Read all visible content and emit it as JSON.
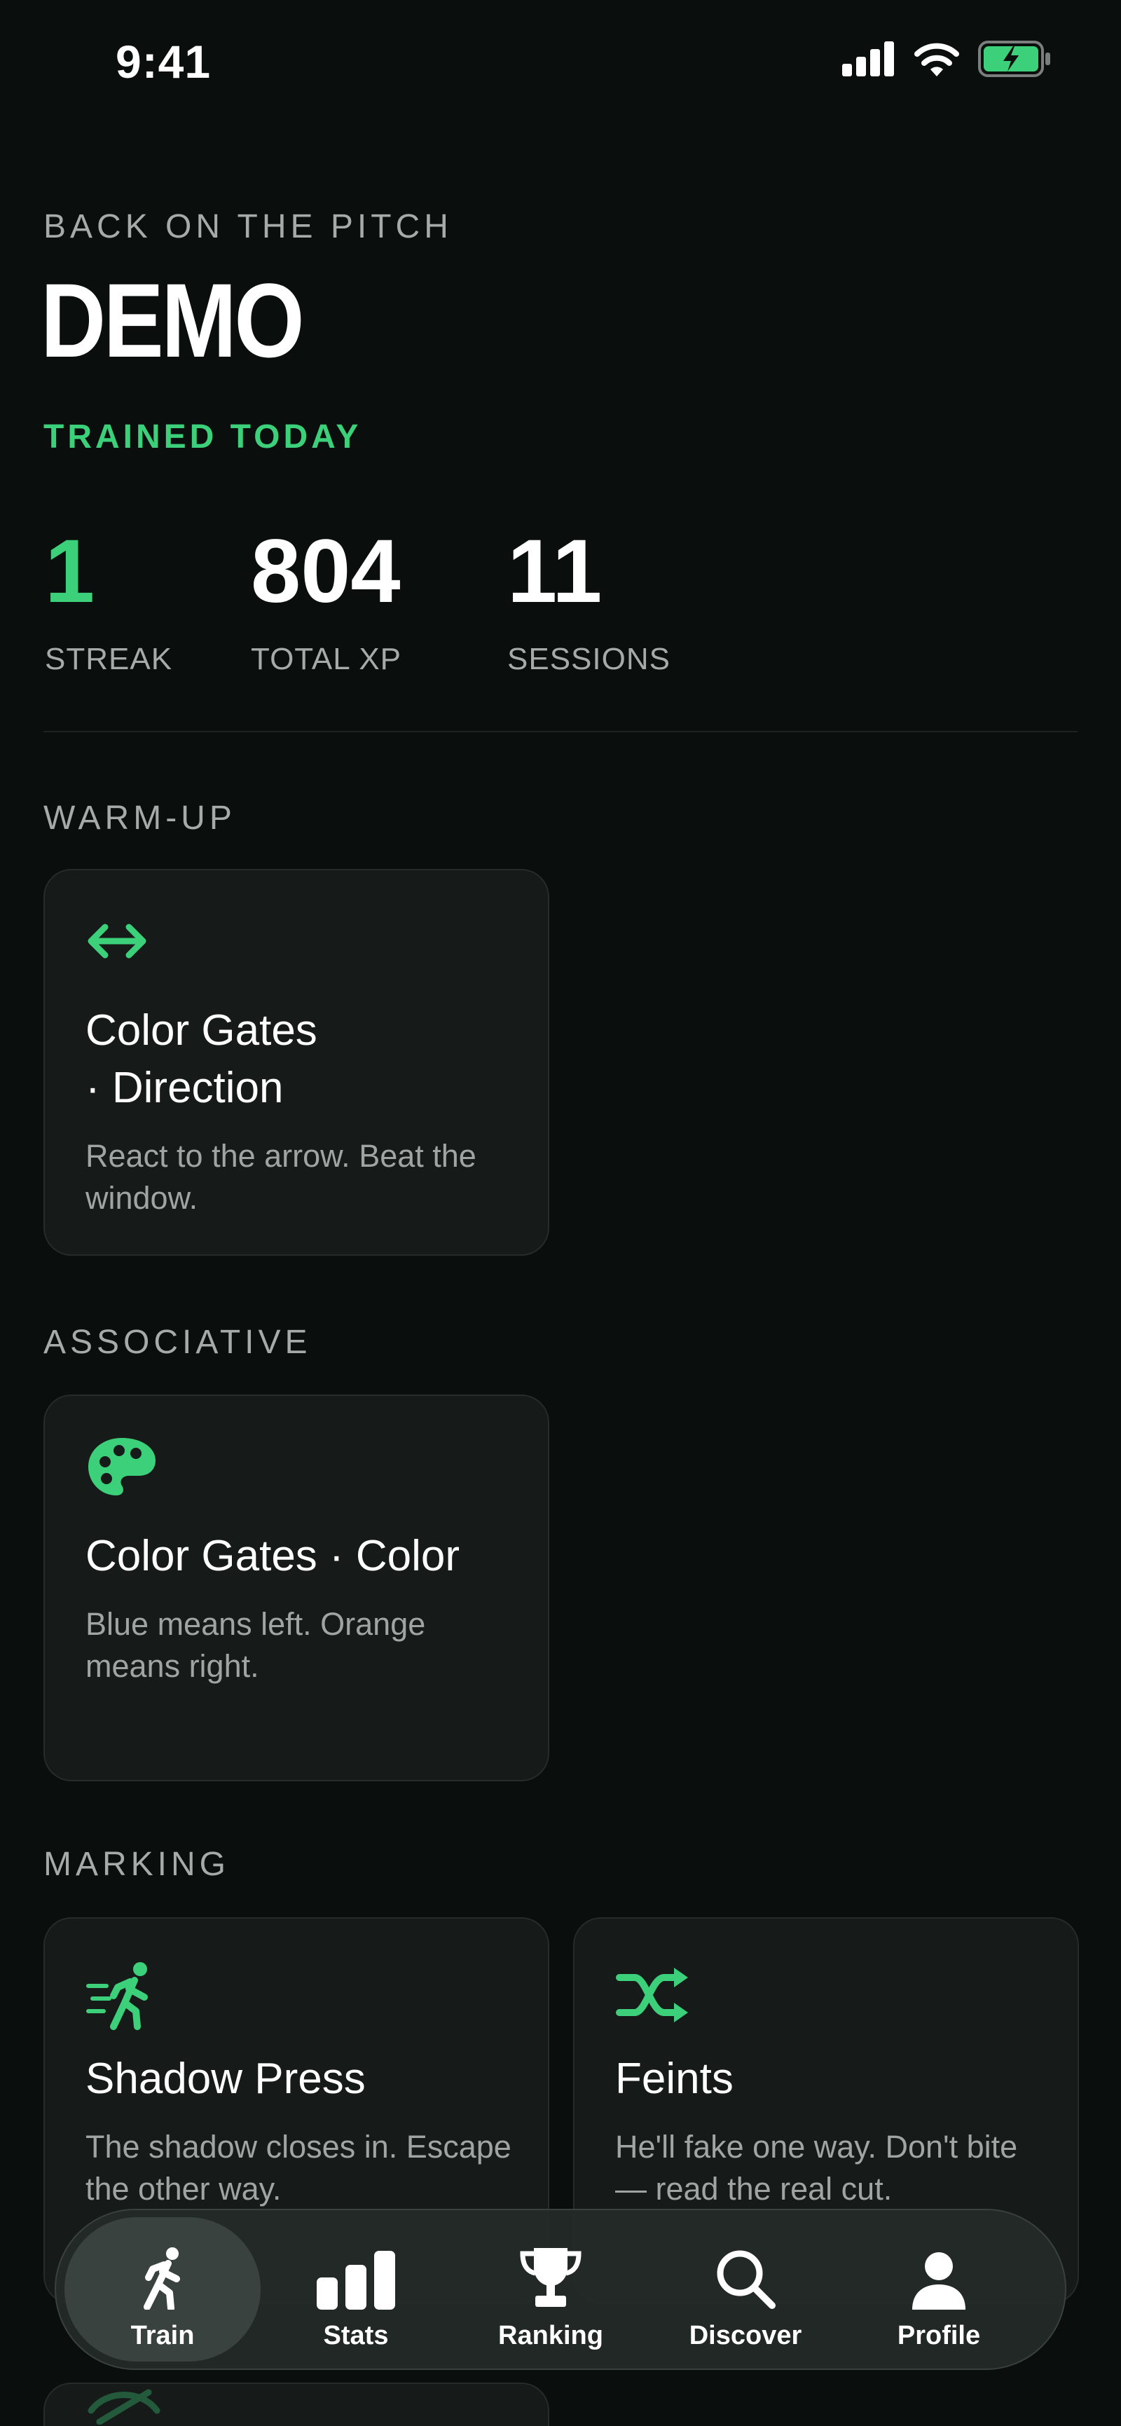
{
  "status_bar": {
    "time": "9:41"
  },
  "header": {
    "eyebrow": "BACK ON THE PITCH",
    "name": "DEMO",
    "status": "TRAINED TODAY"
  },
  "stats": [
    {
      "value": "1",
      "label": "STREAK"
    },
    {
      "value": "804",
      "label": "TOTAL XP"
    },
    {
      "value": "11",
      "label": "SESSIONS"
    }
  ],
  "sections": [
    {
      "title": "WARM-UP",
      "cards": [
        {
          "icon": "left-right-arrow-icon",
          "title_line1": "Color Gates",
          "title_line2": "· Direction",
          "description": "React to the arrow. Beat the window."
        }
      ]
    },
    {
      "title": "ASSOCIATIVE",
      "cards": [
        {
          "icon": "palette-icon",
          "title": "Color Gates · Color",
          "description": "Blue means left. Orange means right."
        }
      ]
    },
    {
      "title": "MARKING",
      "cards": [
        {
          "icon": "running-person-icon",
          "title": "Shadow Press",
          "description": "The shadow closes in. Escape the other way."
        },
        {
          "icon": "shuffle-icon",
          "title": "Feints",
          "description": "He'll fake one way. Don't bite — read the real cut."
        }
      ]
    }
  ],
  "tabbar": {
    "active": "Train",
    "tabs": [
      {
        "label": "Train",
        "icon": "running-figure-icon"
      },
      {
        "label": "Stats",
        "icon": "bar-chart-icon"
      },
      {
        "label": "Ranking",
        "icon": "trophy-icon"
      },
      {
        "label": "Discover",
        "icon": "search-icon"
      },
      {
        "label": "Profile",
        "icon": "person-icon"
      }
    ]
  },
  "colors": {
    "background": "#0a0e0d",
    "accent": "#3dd07b",
    "card": "#161b1a",
    "muted_text": "#a6aaa8"
  }
}
